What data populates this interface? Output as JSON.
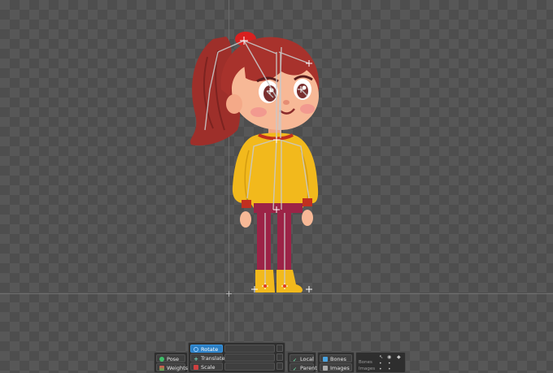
{
  "toolbar": {
    "mode": {
      "pose_label": "Pose",
      "weights_label": "Weights"
    },
    "transform": {
      "rotate_label": "Rotate",
      "translate_label": "Translate",
      "scale_label": "Scale",
      "active": "Rotate"
    },
    "axes": {
      "local_label": "Local",
      "parent_label": "Parent"
    },
    "visibility": {
      "bones_label": "Bones",
      "images_label": "Images"
    },
    "compact": {
      "bones_label": "Bones",
      "images_label": "Images"
    }
  },
  "colors": {
    "accent_active": "#2b7fc4",
    "bone_color": "#c9c9c9",
    "hair": "#a8322c",
    "sweater": "#f2b91c",
    "pants": "#9c2346"
  },
  "icons": [
    "pose-icon",
    "weights-icon",
    "rotate-icon",
    "translate-icon",
    "scale-icon",
    "key-icon",
    "local-icon",
    "parent-icon",
    "bones-icon",
    "images-icon"
  ]
}
